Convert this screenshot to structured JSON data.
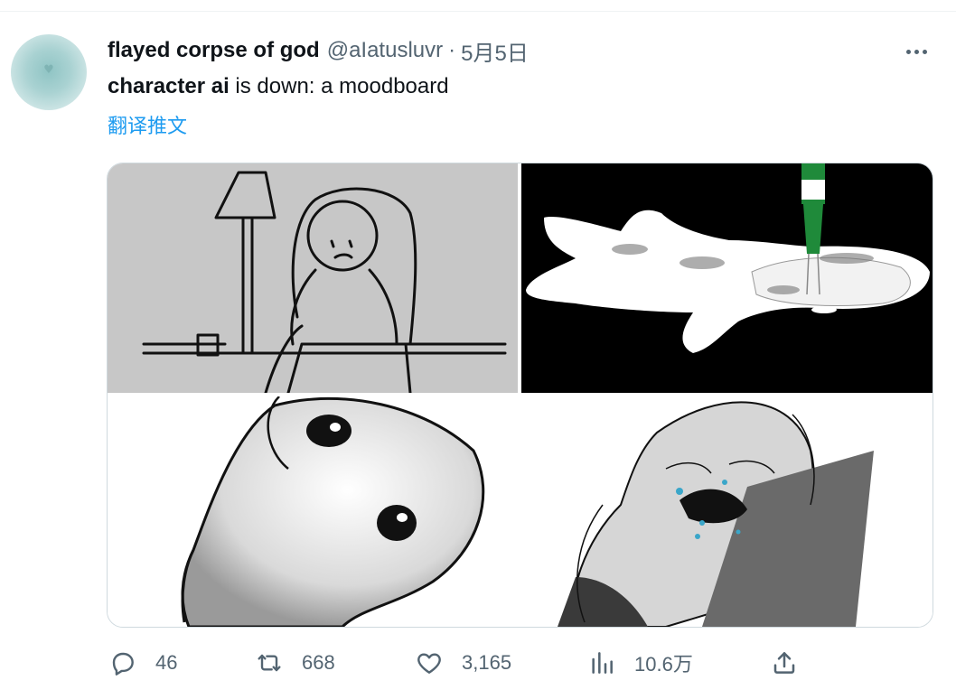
{
  "tweet": {
    "display_name": "flayed corpse of god",
    "handle": "@aIatusluvr",
    "separator": "·",
    "date": "5月5日",
    "text_bold": "character ai",
    "text_rest": " is down: a moodboard",
    "translate_label": "翻译推文"
  },
  "media": {
    "images": [
      {
        "icon": "sad-figure-in-armchair-drawing"
      },
      {
        "icon": "figure-with-bottle-drawing"
      },
      {
        "icon": "wide-eyed-figure-drawing"
      },
      {
        "icon": "crying-figure-drawing"
      }
    ]
  },
  "actions": {
    "reply_count": "46",
    "retweet_count": "668",
    "like_count": "3,165",
    "views_count": "10.6万"
  },
  "colors": {
    "link": "#1d9bf0",
    "secondary_text": "#536471",
    "primary_text": "#0f1419",
    "border": "#cfd9de"
  }
}
